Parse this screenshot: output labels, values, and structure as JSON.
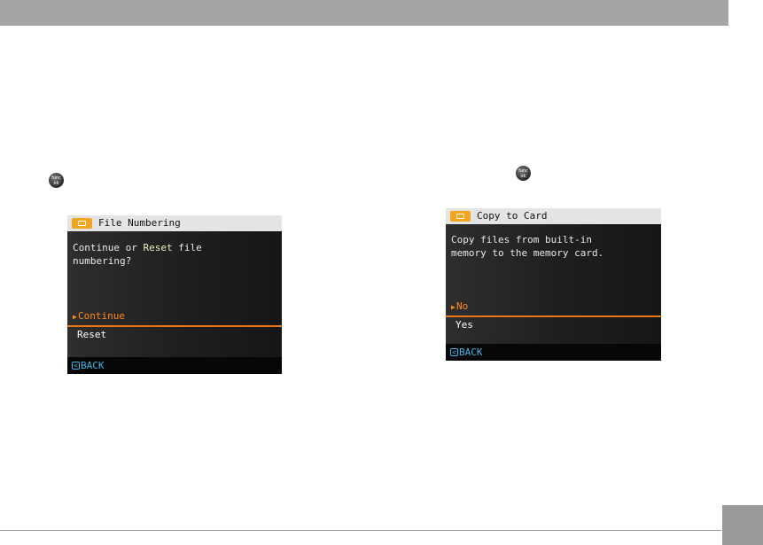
{
  "screen_left": {
    "title": "File Numbering",
    "message_part1": "Continue or ",
    "message_accent": "Reset",
    "message_part2": " file\nnumbering?",
    "options": [
      {
        "label": "Continue",
        "selected": true
      },
      {
        "label": "Reset",
        "selected": false
      }
    ],
    "back_label": "BACK"
  },
  "screen_right": {
    "title": "Copy to Card",
    "message": "Copy files from built-in\nmemory to the memory card.",
    "options": [
      {
        "label": "No",
        "selected": true
      },
      {
        "label": "Yes",
        "selected": false
      }
    ],
    "back_label": "BACK"
  },
  "func_button": {
    "line1": "func",
    "line2": "ok"
  },
  "colors": {
    "header_bar": "#a5a5a5",
    "selected_option": "#ff8a1a",
    "back_text": "#3fb6e8",
    "tab_icon": "#f2a51e"
  },
  "icons": {
    "func_ok": "func-ok-button-icon",
    "menu_tab": "menu-tab-icon",
    "back": "back-arrow-icon",
    "selection_arrow": "selection-arrow-icon"
  }
}
